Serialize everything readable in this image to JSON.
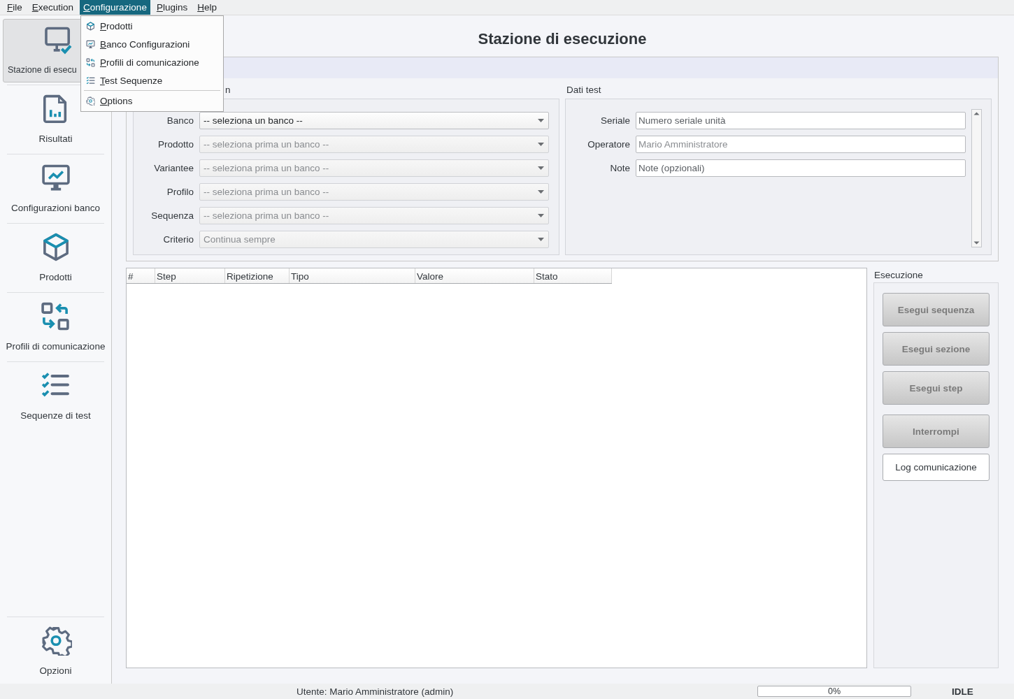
{
  "menu_bar": [
    {
      "label": "File",
      "selected": false
    },
    {
      "label": "Execution",
      "selected": false
    },
    {
      "label": "Configurazione",
      "selected": true
    },
    {
      "label": "Plugins",
      "selected": false
    },
    {
      "label": "Help",
      "selected": false
    }
  ],
  "open_menu": {
    "items": [
      {
        "kind": "item",
        "label": "Prodotti"
      },
      {
        "kind": "item",
        "label": "Banco Configurazioni"
      },
      {
        "kind": "item",
        "label": "Profili di comunicazione"
      },
      {
        "kind": "item",
        "label": "Test Sequenze"
      },
      {
        "kind": "separator"
      },
      {
        "kind": "item",
        "label": "Options"
      }
    ]
  },
  "sidebar": {
    "items": [
      {
        "label": "Stazione di esecu",
        "selected": true
      },
      {
        "label": "Risultati",
        "selected": false
      },
      {
        "label": "Configurazioni banco",
        "selected": false
      },
      {
        "label": "Prodotti",
        "selected": false
      },
      {
        "label": "Profili di comunicazione",
        "selected": false
      },
      {
        "label": "Sequenze di test",
        "selected": false
      }
    ],
    "bottom_item": {
      "label": "Opzioni",
      "selected": false
    }
  },
  "page_title": "Stazione di esecuzione",
  "setup_group": {
    "title": "n",
    "fields": [
      {
        "label": "Banco",
        "value": "-- seleziona un banco --",
        "disabled": false
      },
      {
        "label": "Prodotto",
        "value": "-- seleziona prima un banco --",
        "disabled": true
      },
      {
        "label": "Variantee",
        "value": "-- seleziona prima un banco --",
        "disabled": true
      },
      {
        "label": "Profilo",
        "value": "-- seleziona prima un banco --",
        "disabled": true
      },
      {
        "label": "Sequenza",
        "value": "-- seleziona prima un banco --",
        "disabled": true
      },
      {
        "label": "Criterio",
        "value": "Continua sempre",
        "disabled": true
      }
    ]
  },
  "test_data_group": {
    "title": "Dati test",
    "fields": [
      {
        "label": "Seriale",
        "placeholder": "Numero seriale unità"
      },
      {
        "label": "Operatore",
        "value": "Mario Amministratore",
        "disabled": true
      },
      {
        "label": "Note",
        "placeholder": "Note (opzionali)"
      }
    ]
  },
  "table": {
    "columns": [
      "#",
      "Step",
      "Ripetizione",
      "Tipo",
      "Valore",
      "Stato"
    ]
  },
  "execution": {
    "title": "Esecuzione",
    "buttons": [
      {
        "label": "Esegui sequenza",
        "disabled": true
      },
      {
        "label": "Esegui sezione",
        "disabled": true
      },
      {
        "label": "Esegui step",
        "disabled": true
      },
      {
        "label": "Interrompi",
        "disabled": true
      },
      {
        "label": "Log comunicazione",
        "disabled": false
      }
    ]
  },
  "status_bar": {
    "user": "Utente: Mario Amministratore (admin)",
    "progress": {
      "level": 0,
      "text": "0%"
    },
    "state": "IDLE"
  }
}
